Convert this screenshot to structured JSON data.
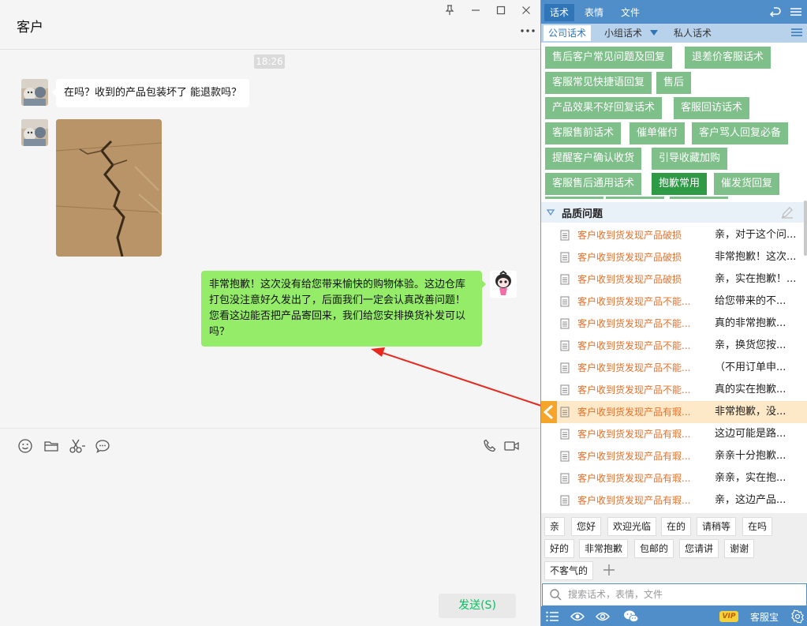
{
  "chat": {
    "title": "客户",
    "timestamp": "18:26",
    "messages": [
      {
        "text": "在吗？收到的产品包装坏了 能退款吗？"
      },
      {
        "text": "非常抱歉！这次没有给您带来愉快的购物体验。这边仓库打包没注意好久发出了，后面我们一定会认真改善问题！您看这边能否把产品寄回来，我们给您安排换货补发可以吗？"
      }
    ],
    "send_label": "发送(S)"
  },
  "panel": {
    "top_tabs": [
      "话术",
      "表情",
      "文件"
    ],
    "sub_tabs": [
      "公司话术",
      "小组话术",
      "私人话术"
    ],
    "categories": [
      "售后客户常见问题及回复",
      "退差价客服话术",
      "客服常见快捷语回复",
      "售后",
      "产品效果不好回复话术",
      "客服回访话术",
      "客服售前话术",
      "催单催付",
      "客户骂人回复必备",
      "提醒客户确认收货",
      "引导收藏加购",
      "客服售后通用话术",
      "抱歉常用",
      "催发货回复"
    ],
    "section_title": "品质问题",
    "scripts": [
      {
        "category": "客户收到货发现产品破损",
        "text": "亲，对于这个问..."
      },
      {
        "category": "客户收到货发现产品破损",
        "text": "非常抱歉！这次..."
      },
      {
        "category": "客户收到货发现产品破损",
        "text": "亲，实在抱歉！..."
      },
      {
        "category": "客户收到货发现产品不能...",
        "text": "给您带来的不..."
      },
      {
        "category": "客户收到货发现产品不能...",
        "text": "真的非常抱歉..."
      },
      {
        "category": "客户收到货发现产品不能...",
        "text": "亲，换货您按..."
      },
      {
        "category": "客户收到货发现产品不能...",
        "text": "（不用订单申..."
      },
      {
        "category": "客户收到货发现产品不能...",
        "text": "真的实在抱歉..."
      },
      {
        "category": "客户收到货发现产品有瑕...",
        "text": "非常抱歉，没..."
      },
      {
        "category": "客户收到货发现产品有瑕...",
        "text": "这边可能是路..."
      },
      {
        "category": "客户收到货发现产品有瑕...",
        "text": "亲亲十分抱歉..."
      },
      {
        "category": "客户收到货发现产品有瑕...",
        "text": "亲亲，实在抱..."
      },
      {
        "category": "客户收到货发现产品有瑕...",
        "text": "亲，这边产品..."
      }
    ],
    "quick_phrases": [
      "亲",
      "您好",
      "欢迎光临",
      "在的",
      "请稍等",
      "在吗",
      "好的",
      "非常抱歉",
      "包邮的",
      "您请讲",
      "谢谢",
      "不客气的"
    ],
    "search_placeholder": "搜索话术，表情，文件",
    "vip_label": "VIP",
    "app_name": "客服宝"
  }
}
